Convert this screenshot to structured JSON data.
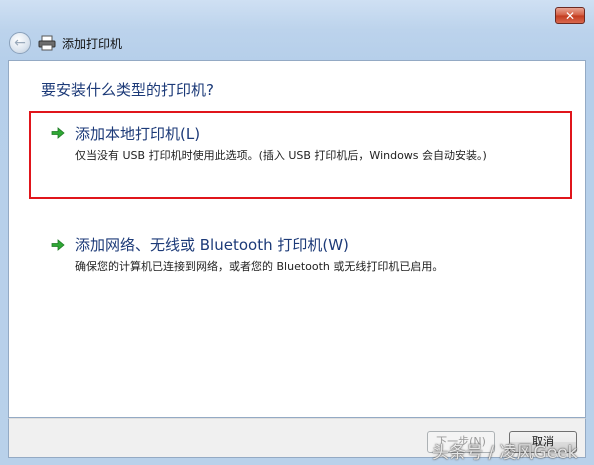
{
  "window": {
    "title": "添加打印机",
    "close_label": "✕"
  },
  "main": {
    "heading": "要安装什么类型的打印机?",
    "options": [
      {
        "title": "添加本地打印机(L)",
        "description": "仅当没有 USB 打印机时使用此选项。(插入 USB 打印机后，Windows 会自动安装。)",
        "highlighted": true
      },
      {
        "title": "添加网络、无线或 Bluetooth 打印机(W)",
        "description": "确保您的计算机已连接到网络，或者您的 Bluetooth 或无线打印机已启用。",
        "highlighted": false
      }
    ]
  },
  "footer": {
    "next_label": "下一步(N)",
    "cancel_label": "取消"
  },
  "watermark": "头条号 / 凌风Geek",
  "colors": {
    "heading": "#1c3a78",
    "highlight_border": "#e0151b",
    "arrow": "#2fa835"
  }
}
